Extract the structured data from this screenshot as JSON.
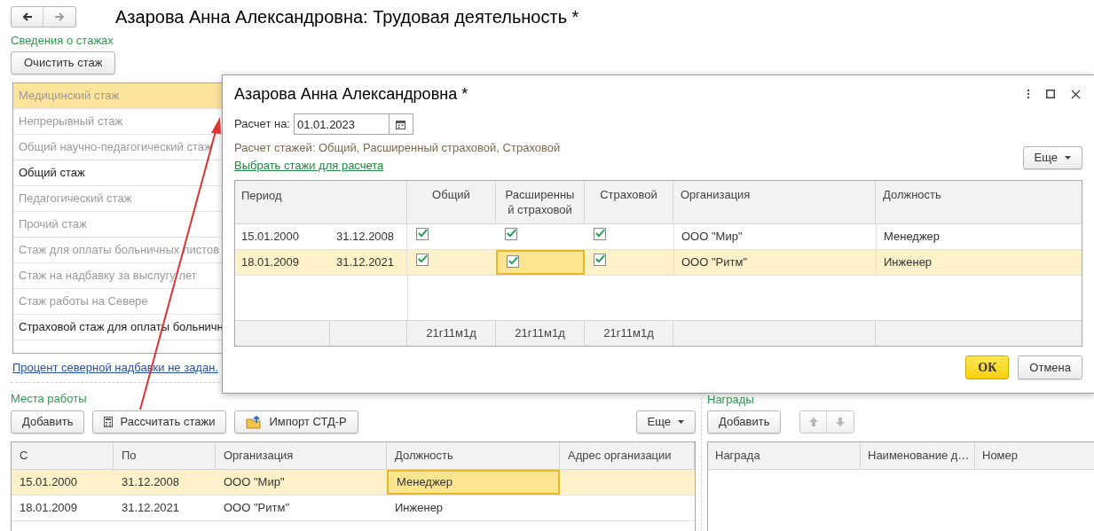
{
  "page": {
    "title": "Азарова Анна Александровна: Трудовая деятельность *",
    "nav": [
      {
        "kind": "back",
        "disabled": false
      },
      {
        "kind": "forward",
        "disabled": true
      }
    ]
  },
  "seniority": {
    "heading": "Сведения о стажах",
    "clear_button": "Очистить стаж",
    "items": [
      {
        "label": "Медицинский стаж",
        "selected": true,
        "dimmed": true
      },
      {
        "label": "Непрерывный стаж",
        "selected": false,
        "dimmed": true
      },
      {
        "label": "Общий научно-педагогический стаж",
        "selected": false,
        "dimmed": true
      },
      {
        "label": "Общий стаж",
        "selected": false,
        "dimmed": false
      },
      {
        "label": "Педагогический стаж",
        "selected": false,
        "dimmed": true
      },
      {
        "label": "Прочий стаж",
        "selected": false,
        "dimmed": true
      },
      {
        "label": "Стаж для оплаты больничных листов",
        "selected": false,
        "dimmed": true
      },
      {
        "label": "Стаж на надбавку за выслугу лет",
        "selected": false,
        "dimmed": true
      },
      {
        "label": "Стаж работы на Севере",
        "selected": false,
        "dimmed": true
      },
      {
        "label": "Страховой стаж для оплаты больничн",
        "selected": false,
        "dimmed": false
      }
    ],
    "north_link": "Процент северной надбавки не задан."
  },
  "workplaces": {
    "heading": "Места работы",
    "buttons": [
      {
        "kind": "plain",
        "label": "Добавить"
      },
      {
        "kind": "calc",
        "label": "Рассчитать стажи"
      },
      {
        "kind": "import",
        "label": "Импорт СТД-Р"
      }
    ],
    "more_button": "Еще",
    "columns": [
      "С",
      "По",
      "Организация",
      "Должность",
      "Адрес организации"
    ],
    "rows": [
      {
        "selected": true,
        "cells": [
          {
            "text": "15.01.2000",
            "focused": false
          },
          {
            "text": "31.12.2008",
            "focused": false
          },
          {
            "text": "ООО \"Мир\"",
            "focused": false
          },
          {
            "text": "Менеджер",
            "focused": true
          }
        ]
      },
      {
        "selected": false,
        "cells": [
          {
            "text": "18.01.2009",
            "focused": false
          },
          {
            "text": "31.12.2021",
            "focused": false
          },
          {
            "text": "ООО \"Ритм\"",
            "focused": false
          },
          {
            "text": "Инженер",
            "focused": false
          }
        ]
      }
    ]
  },
  "awards": {
    "heading": "Награды",
    "add_button": "Добавить",
    "move_buttons": [
      {
        "kind": "up",
        "disabled": true
      },
      {
        "kind": "down",
        "disabled": true
      }
    ],
    "columns": [
      "Награда",
      "Наименование д…",
      "Номер"
    ]
  },
  "dialog": {
    "title": "Азарова Анна Александровна *",
    "date_label": "Расчет на:",
    "date_value": "01.01.2023",
    "summary": "Расчет стажей: Общий, Расширенный страховой, Страховой",
    "select_link": "Выбрать стажи для расчета",
    "more_button": "Еще",
    "columns": [
      "Период",
      "Общий",
      "Расширенный страховой",
      "Страховой",
      "Организация",
      "Должность"
    ],
    "rows": [
      {
        "selected": false,
        "start": "15.01.2000",
        "end": "31.12.2008",
        "checks": [
          {
            "checked": true,
            "focused": false
          },
          {
            "checked": true,
            "focused": false
          },
          {
            "checked": true,
            "focused": false
          }
        ],
        "organization": "ООО \"Мир\"",
        "position": "Менеджер"
      },
      {
        "selected": true,
        "start": "18.01.2009",
        "end": "31.12.2021",
        "checks": [
          {
            "checked": true,
            "focused": false
          },
          {
            "checked": true,
            "focused": true
          },
          {
            "checked": true,
            "focused": false
          }
        ],
        "organization": "ООО \"Ритм\"",
        "position": "Инженер"
      }
    ],
    "totals": [
      "21г11м1д",
      "21г11м1д",
      "21г11м1д"
    ],
    "ok_button": "ОК",
    "cancel_button": "Отмена"
  }
}
